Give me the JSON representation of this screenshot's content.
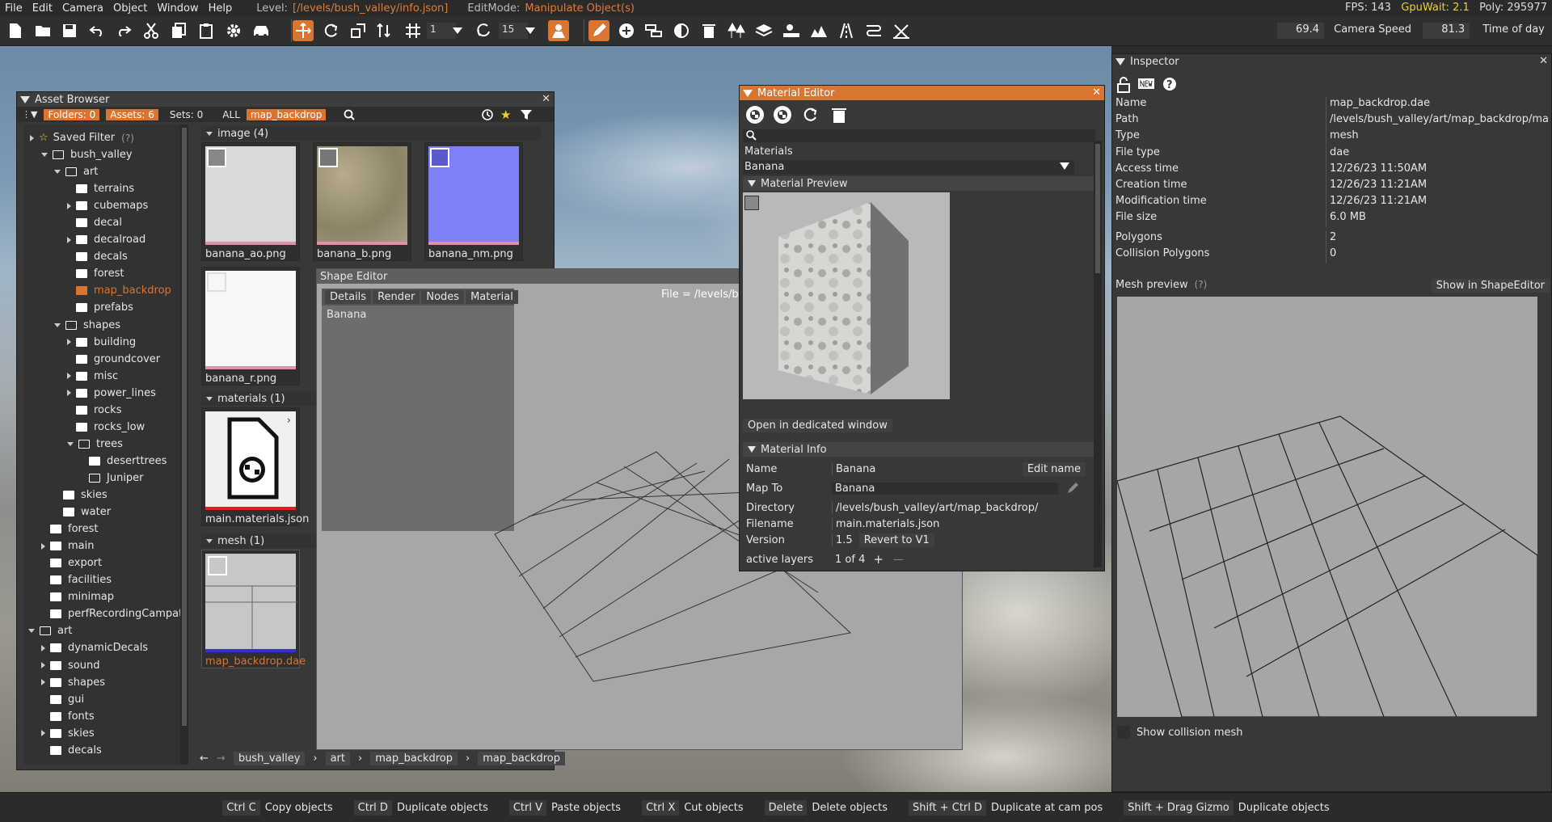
{
  "menu": {
    "items": [
      "File",
      "Edit",
      "Camera",
      "Object",
      "Window",
      "Help"
    ],
    "level_label": "Level:",
    "level_value": "[/levels/bush_valley/info.json]",
    "editmode_label": "EditMode:",
    "editmode_value": "Manipulate Object(s)"
  },
  "stats": {
    "fps": "FPS: 143",
    "gpuwait": "GpuWait: 2.1",
    "poly": "Poly: 295977"
  },
  "toolbar": {
    "grid_value": "1",
    "snap_value": "15",
    "camera_fov": "69.4",
    "camera_speed_label": "Camera Speed",
    "camera_speed_value": "81.3",
    "time_of_day_label": "Time of day"
  },
  "asset_browser": {
    "title": "Asset Browser",
    "folders": "Folders: 0",
    "assets": "Assets: 6",
    "sets": "Sets: 0",
    "all": "ALL",
    "filter_tag": "map_backdrop",
    "saved_filter": "Saved Filter",
    "saved_filter_help": "(?)",
    "tree": [
      {
        "label": "bush_valley"
      },
      {
        "label": "art"
      },
      {
        "label": "terrains"
      },
      {
        "label": "cubemaps"
      },
      {
        "label": "decal"
      },
      {
        "label": "decalroad"
      },
      {
        "label": "decals"
      },
      {
        "label": "forest"
      },
      {
        "label": "map_backdrop"
      },
      {
        "label": "prefabs"
      },
      {
        "label": "shapes"
      },
      {
        "label": "building"
      },
      {
        "label": "groundcover"
      },
      {
        "label": "misc"
      },
      {
        "label": "power_lines"
      },
      {
        "label": "rocks"
      },
      {
        "label": "rocks_low"
      },
      {
        "label": "trees"
      },
      {
        "label": "deserttrees"
      },
      {
        "label": "Juniper"
      },
      {
        "label": "skies"
      },
      {
        "label": "water"
      },
      {
        "label": "forest"
      },
      {
        "label": "main"
      },
      {
        "label": "export"
      },
      {
        "label": "facilities"
      },
      {
        "label": "minimap"
      },
      {
        "label": "perfRecordingCampaths"
      },
      {
        "label": "art"
      },
      {
        "label": "dynamicDecals"
      },
      {
        "label": "sound"
      },
      {
        "label": "shapes"
      },
      {
        "label": "gui"
      },
      {
        "label": "fonts"
      },
      {
        "label": "skies"
      },
      {
        "label": "decals"
      }
    ],
    "sections": {
      "image": "image (4)",
      "materials": "materials (1)",
      "mesh": "mesh (1)"
    },
    "files": [
      "banana_ao.png",
      "banana_b.png",
      "banana_nm.png",
      "banana_r.png",
      "main.materials.json",
      "map_backdrop.dae"
    ],
    "breadcrumb": [
      "bush_valley",
      "art",
      "map_backdrop",
      "map_backdrop"
    ]
  },
  "shape_editor": {
    "title": "Shape Editor",
    "tabs": [
      "Details",
      "Render",
      "Nodes",
      "Material"
    ],
    "item": "Banana",
    "file_label": "File = /levels/bus"
  },
  "material_editor": {
    "title": "Material Editor",
    "materials_label": "Materials",
    "material_selected": "Banana",
    "preview_header": "Material Preview",
    "open_window": "Open in dedicated window",
    "info_header": "Material Info",
    "name_label": "Name",
    "name_value": "Banana",
    "edit_name": "Edit name",
    "mapto_label": "Map To",
    "mapto_value": "Banana",
    "dir_label": "Directory",
    "dir_value": "/levels/bush_valley/art/map_backdrop/",
    "file_label": "Filename",
    "file_value": "main.materials.json",
    "version_label": "Version",
    "version_value": "1.5",
    "revert": "Revert to V1",
    "layers_label": "active layers",
    "layers_value": "1 of 4"
  },
  "inspector": {
    "title": "Inspector",
    "rows": [
      {
        "k": "Name",
        "v": "map_backdrop.dae"
      },
      {
        "k": "Path",
        "v": "/levels/bush_valley/art/map_backdrop/map_b"
      },
      {
        "k": "Type",
        "v": "mesh"
      },
      {
        "k": "File type",
        "v": "dae"
      },
      {
        "k": "Access time",
        "v": "12/26/23 11:50AM"
      },
      {
        "k": "Creation time",
        "v": "12/26/23 11:21AM"
      },
      {
        "k": "Modification time",
        "v": "12/26/23 11:21AM"
      },
      {
        "k": "File size",
        "v": "6.0 MB"
      },
      {
        "k": "Polygons",
        "v": "2"
      },
      {
        "k": "Collision Polygons",
        "v": "0"
      }
    ],
    "mesh_preview": "Mesh preview",
    "mesh_help": "(?)",
    "show_in_shape_editor": "Show in ShapeEditor",
    "show_collision": "Show collision mesh"
  },
  "statusbar": [
    {
      "key": "Ctrl C",
      "action": "Copy objects"
    },
    {
      "key": "Ctrl D",
      "action": "Duplicate objects"
    },
    {
      "key": "Ctrl V",
      "action": "Paste objects"
    },
    {
      "key": "Ctrl X",
      "action": "Cut objects"
    },
    {
      "key": "Delete",
      "action": "Delete objects"
    },
    {
      "key": "Shift + Ctrl D",
      "action": "Duplicate at cam pos"
    },
    {
      "key": "Shift + Drag Gizmo",
      "action": "Duplicate objects"
    }
  ],
  "colors": {
    "accent": "#d97530",
    "yellow": "#f0d030"
  }
}
